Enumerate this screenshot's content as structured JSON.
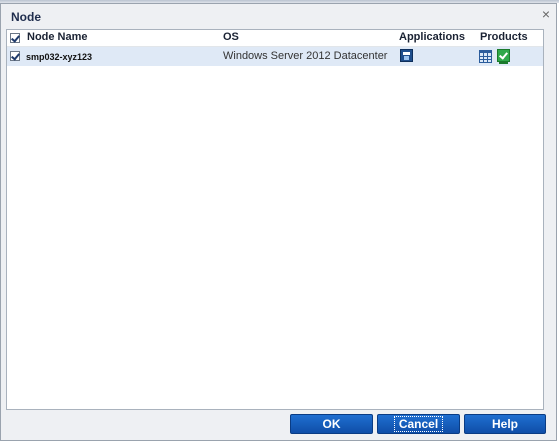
{
  "dialog": {
    "title": "Node",
    "close_glyph": "×"
  },
  "grid": {
    "columns": {
      "select_all_checked": true,
      "node_name": "Node Name",
      "os": "OS",
      "applications": "Applications",
      "products": "Products"
    },
    "rows": [
      {
        "checked": true,
        "node_name": "smp032-xyz123",
        "os": "Windows Server 2012 Datacenter",
        "applications_icon": "database-app-icon",
        "products_icons": [
          "grid-product-icon",
          "monitor-check-icon"
        ]
      }
    ]
  },
  "buttons": {
    "ok": "OK",
    "cancel": "Cancel",
    "help": "Help"
  },
  "colors": {
    "button_blue": "#1563c4",
    "row_selected": "#dfe9f6",
    "title_text": "#1f2d4d"
  }
}
